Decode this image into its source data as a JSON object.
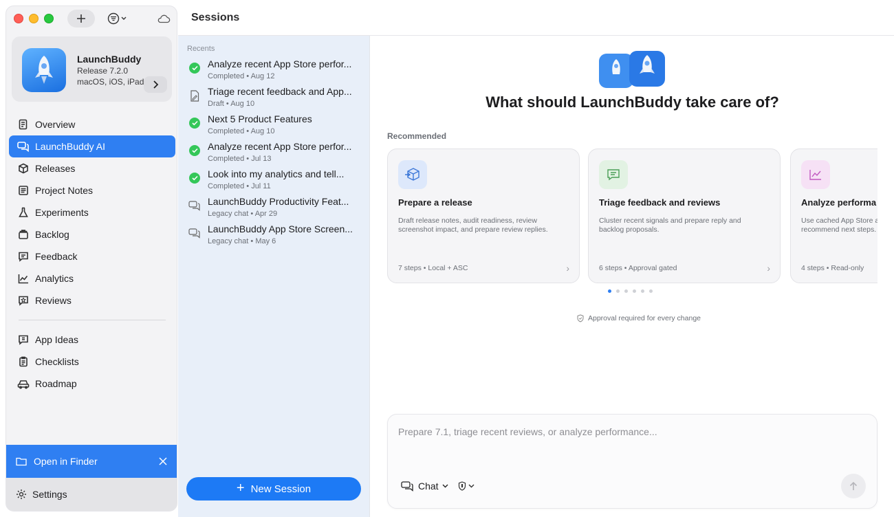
{
  "window": {
    "title": "Sessions"
  },
  "sidebar": {
    "app": {
      "name": "LaunchBuddy",
      "release": "Release 7.2.0",
      "platforms": "macOS, iOS, iPadOS"
    },
    "items": [
      {
        "label": "Overview",
        "icon": "overview-icon"
      },
      {
        "label": "LaunchBuddy AI",
        "icon": "chat-icon",
        "active": true
      },
      {
        "label": "Releases",
        "icon": "box-icon"
      },
      {
        "label": "Project Notes",
        "icon": "notes-icon"
      },
      {
        "label": "Experiments",
        "icon": "flask-icon"
      },
      {
        "label": "Backlog",
        "icon": "tray-icon"
      },
      {
        "label": "Feedback",
        "icon": "feedback-icon"
      },
      {
        "label": "Analytics",
        "icon": "chart-icon"
      },
      {
        "label": "Reviews",
        "icon": "star-bubble-icon"
      }
    ],
    "secondary_items": [
      {
        "label": "App Ideas",
        "icon": "lightbulb-bubble-icon"
      },
      {
        "label": "Checklists",
        "icon": "clipboard-icon"
      },
      {
        "label": "Roadmap",
        "icon": "car-icon"
      }
    ],
    "finder_label": "Open in Finder",
    "settings_label": "Settings"
  },
  "sessions": {
    "section_label": "Recents",
    "items": [
      {
        "title": "Analyze recent App Store perfor...",
        "status": "Completed",
        "date": "Aug 12",
        "icon": "check-icon"
      },
      {
        "title": "Triage recent feedback and App...",
        "status": "Draft",
        "date": "Aug 10",
        "icon": "draft-icon"
      },
      {
        "title": "Next 5 Product Features",
        "status": "Completed",
        "date": "Aug 10",
        "icon": "check-icon"
      },
      {
        "title": "Analyze recent App Store perfor...",
        "status": "Completed",
        "date": "Jul 13",
        "icon": "check-icon"
      },
      {
        "title": "Look into my analytics and tell...",
        "status": "Completed",
        "date": "Jul 11",
        "icon": "check-icon"
      },
      {
        "title": "LaunchBuddy Productivity Feat...",
        "status": "Legacy chat",
        "date": "Apr 29",
        "icon": "chat-icon"
      },
      {
        "title": "LaunchBuddy App Store Screen...",
        "status": "Legacy chat",
        "date": "May 6",
        "icon": "chat-icon"
      }
    ],
    "separator": "•",
    "new_session_label": "New Session"
  },
  "main": {
    "heading": "What should LaunchBuddy take care of?",
    "recommended_label": "Recommended",
    "cards": [
      {
        "title": "Prepare a release",
        "description": "Draft release notes, audit readiness, review screenshot impact, and prepare review replies.",
        "steps": "7 steps",
        "scope": "Local + ASC",
        "icon": "box-arrow-icon",
        "icon_bg": "#dde8fb",
        "icon_color": "#3d78d8"
      },
      {
        "title": "Triage feedback and reviews",
        "description": "Cluster recent signals and prepare reply and backlog proposals.",
        "steps": "6 steps",
        "scope": "Approval gated",
        "icon": "message-icon",
        "icon_bg": "#e2f2e3",
        "icon_color": "#4a9e56"
      },
      {
        "title": "Analyze performa",
        "description": "Use cached App Store a recommend next steps.",
        "steps": "4 steps",
        "scope": "Read-only",
        "icon": "chart-icon",
        "icon_bg": "#f6e1f5",
        "icon_color": "#c157c0"
      }
    ],
    "pager": {
      "count": 6,
      "active": 0
    },
    "approval_note": "Approval required for every change",
    "composer": {
      "placeholder": "Prepare 7.1, triage recent reviews, or analyze performance...",
      "value": "",
      "mode_label": "Chat"
    }
  },
  "colors": {
    "accent": "#2f7ff2",
    "new_session": "#1d7af5",
    "completed": "#34c759",
    "sessions_bg": "#e8eff9"
  }
}
